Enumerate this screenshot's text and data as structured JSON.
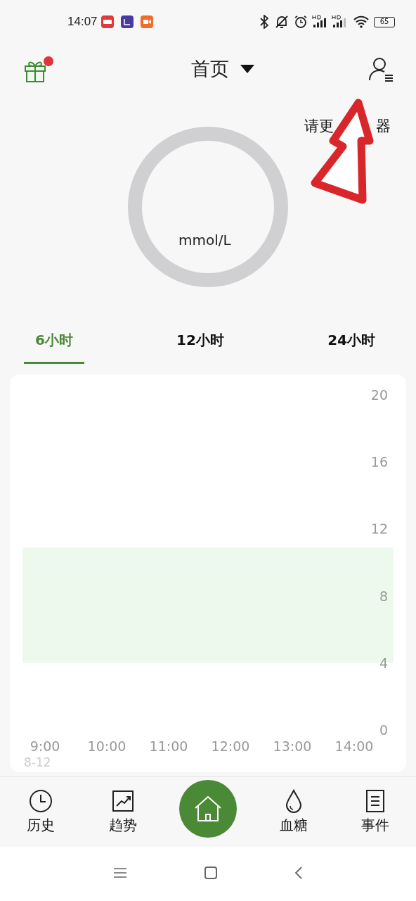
{
  "status_bar": {
    "time": "14:07",
    "battery": "65"
  },
  "header": {
    "title": "首页",
    "has_notification": true
  },
  "sensor_notice": {
    "parts": [
      "请更",
      "器"
    ]
  },
  "gauge": {
    "unit": "mmol/L"
  },
  "range_tabs": [
    {
      "label": "6小时",
      "selected": true
    },
    {
      "label": "12小时",
      "selected": false
    },
    {
      "label": "24小时",
      "selected": false
    }
  ],
  "chart": {
    "chart_data": {
      "type": "line",
      "ylim": [
        0,
        20
      ],
      "yticks": [
        20,
        16,
        12,
        8,
        4,
        0
      ],
      "xticks": [
        {
          "value": 9,
          "label": "9:00"
        },
        {
          "value": 10,
          "label": "10:00"
        },
        {
          "value": 11,
          "label": "11:00"
        },
        {
          "value": 12,
          "label": "12:00"
        },
        {
          "value": 13,
          "label": "13:00"
        },
        {
          "value": 14,
          "label": "14:00"
        }
      ],
      "xlim": [
        9,
        14
      ],
      "bands": [
        {
          "axis": "y",
          "from": 4,
          "to": 10.9
        }
      ]
    },
    "date": "8-12"
  },
  "bottom_nav": [
    {
      "label": "历史",
      "kind": "history",
      "selected": false
    },
    {
      "label": "趋势",
      "kind": "trend",
      "selected": false
    },
    {
      "kind": "home",
      "selected": true
    },
    {
      "label": "血糖",
      "kind": "glucose",
      "selected": false
    },
    {
      "label": "事件",
      "kind": "events",
      "selected": false
    }
  ]
}
